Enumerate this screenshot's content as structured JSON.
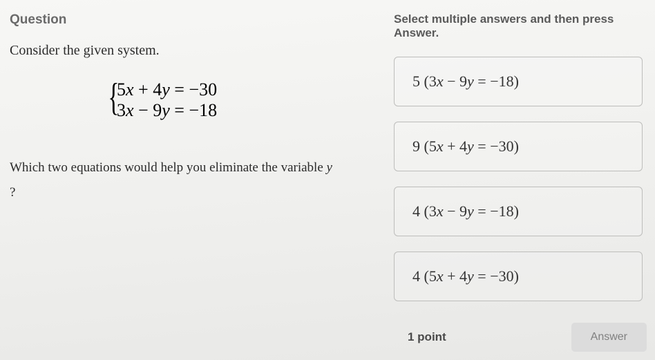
{
  "header": {
    "question_label": "Question",
    "instruction": "Select multiple answers and then press Answer."
  },
  "question": {
    "intro": "Consider the given system.",
    "system": {
      "line1": "5x + 4y = −30",
      "line2": "3x − 9y = −18"
    },
    "prompt": "Which two equations would help you eliminate the variable y ?"
  },
  "choices": [
    {
      "label": "5 (3x − 9y = −18)"
    },
    {
      "label": "9 (5x + 4y = −30)"
    },
    {
      "label": "4 (3x − 9y = −18)"
    },
    {
      "label": "4 (5x + 4y = −30)"
    }
  ],
  "footer": {
    "points": "1 point",
    "answer_button": "Answer"
  }
}
